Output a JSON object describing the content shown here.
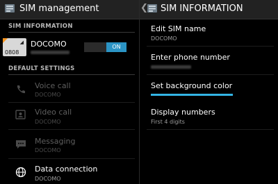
{
  "left": {
    "title": "SIM management",
    "section_sim": "SIM INFORMATION",
    "sim": {
      "name": "DOCOMO",
      "number_label": "0808",
      "status": "ON"
    },
    "section_defaults": "DEFAULT SETTINGS",
    "items": [
      {
        "title": "Voice call",
        "subtitle": "DOCOMO",
        "icon": "phone-icon",
        "enabled": false
      },
      {
        "title": "Video call",
        "subtitle": "DOCOMO",
        "icon": "video-call-icon",
        "enabled": false
      },
      {
        "title": "Messaging",
        "subtitle": "DOCOMO",
        "icon": "message-icon",
        "enabled": false
      },
      {
        "title": "Data connection",
        "subtitle": "DOCOMO",
        "icon": "globe-icon",
        "enabled": true
      }
    ]
  },
  "right": {
    "title": "SIM INFORMATION",
    "items": [
      {
        "title": "Edit SIM name",
        "subtitle": "DOCOMO"
      },
      {
        "title": "Enter phone number",
        "subtitle": ""
      },
      {
        "title": "Set background color",
        "subtitle": ""
      },
      {
        "title": "Display numbers",
        "subtitle": "First 4 digits"
      }
    ]
  },
  "colors": {
    "accent": "#33b5e5",
    "sim_corner": "#f7941d",
    "toggle_on": "#2b94c5"
  }
}
